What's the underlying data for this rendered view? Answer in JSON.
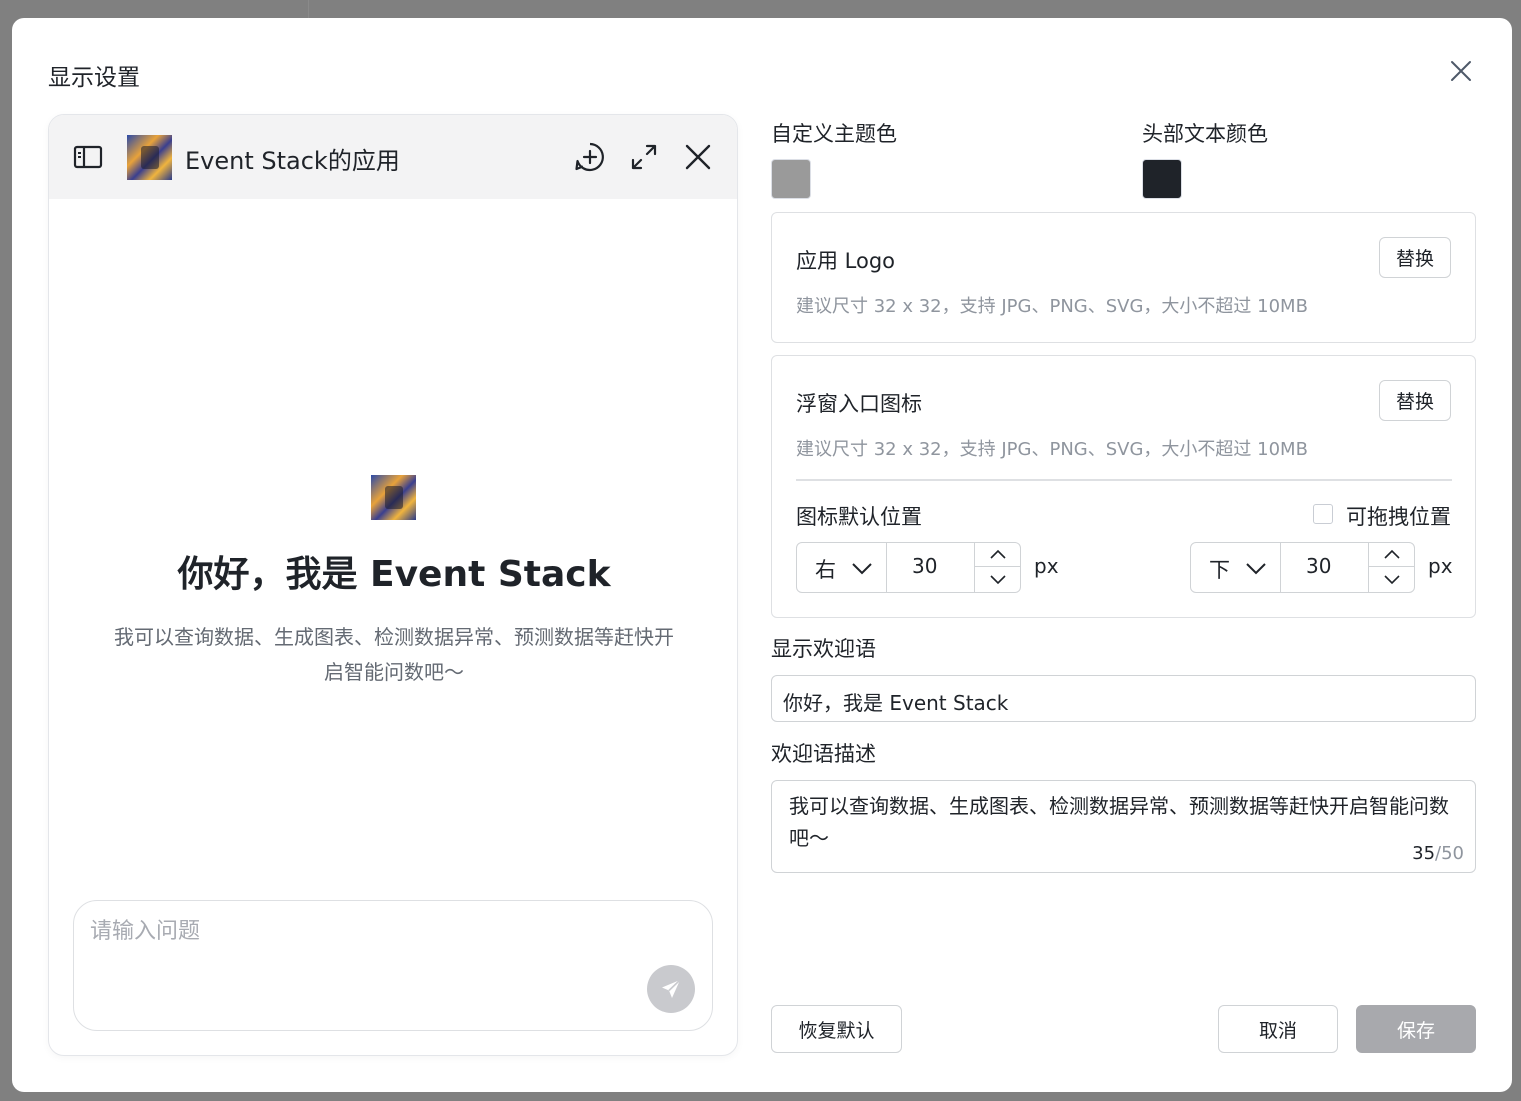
{
  "dialog": {
    "title": "显示设置"
  },
  "preview": {
    "app_title": "Event Stack的应用",
    "welcome_title": "你好，我是 Event Stack",
    "welcome_desc": "我可以查询数据、生成图表、检测数据异常、预测数据等赶快开启智能问数吧～",
    "input_placeholder": "请输入问题"
  },
  "theme": {
    "theme_color_label": "自定义主题色",
    "theme_color": "#9a9a9a",
    "header_text_color_label": "头部文本颜色",
    "header_text_color": "#1f2329"
  },
  "app_logo": {
    "title": "应用 Logo",
    "hint": "建议尺寸 32 x 32，支持 JPG、PNG、SVG，大小不超过 10MB",
    "replace_label": "替换"
  },
  "float_icon": {
    "title": "浮窗入口图标",
    "hint": "建议尺寸 32 x 32，支持 JPG、PNG、SVG，大小不超过 10MB",
    "replace_label": "替换",
    "position_label": "图标默认位置",
    "draggable_label": "可拖拽位置",
    "draggable_checked": false,
    "horizontal": {
      "side": "右",
      "value": "30",
      "unit": "px"
    },
    "vertical": {
      "side": "下",
      "value": "30",
      "unit": "px"
    }
  },
  "welcome": {
    "label": "显示欢迎语",
    "value": "你好，我是 Event Stack"
  },
  "welcome_desc": {
    "label": "欢迎语描述",
    "value": "我可以查询数据、生成图表、检测数据异常、预测数据等赶快开启智能问数吧～",
    "count": "35",
    "max": "/50"
  },
  "footer": {
    "reset_label": "恢复默认",
    "cancel_label": "取消",
    "save_label": "保存"
  }
}
